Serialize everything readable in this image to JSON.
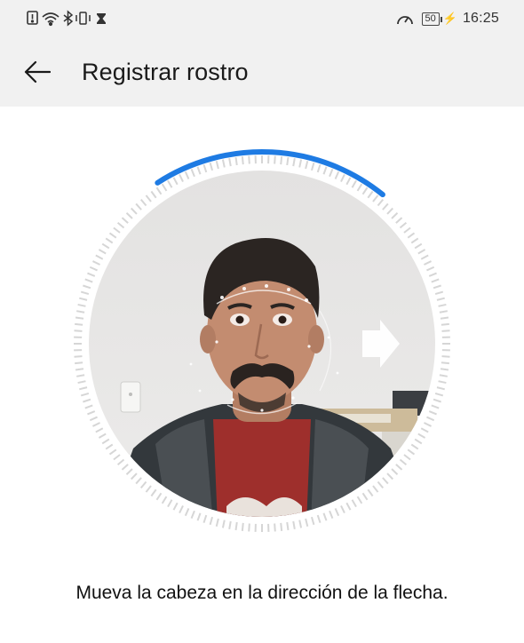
{
  "status_bar": {
    "time": "16:25",
    "battery_level": "50",
    "icons": [
      "notification-alert-icon",
      "wifi-icon",
      "bluetooth-icon",
      "vibrate-icon",
      "hourglass-icon",
      "speedometer-icon",
      "battery-icon",
      "charging-icon"
    ]
  },
  "app_bar": {
    "title": "Registrar rostro",
    "back_icon": "arrow-left-icon"
  },
  "face_scan": {
    "progress": 0.2,
    "direction_arrow": "right",
    "accent_color": "#1e7be3",
    "ring_tick_color": "#d6d6d6"
  },
  "instruction": "Mueva la cabeza en la dirección de la flecha."
}
